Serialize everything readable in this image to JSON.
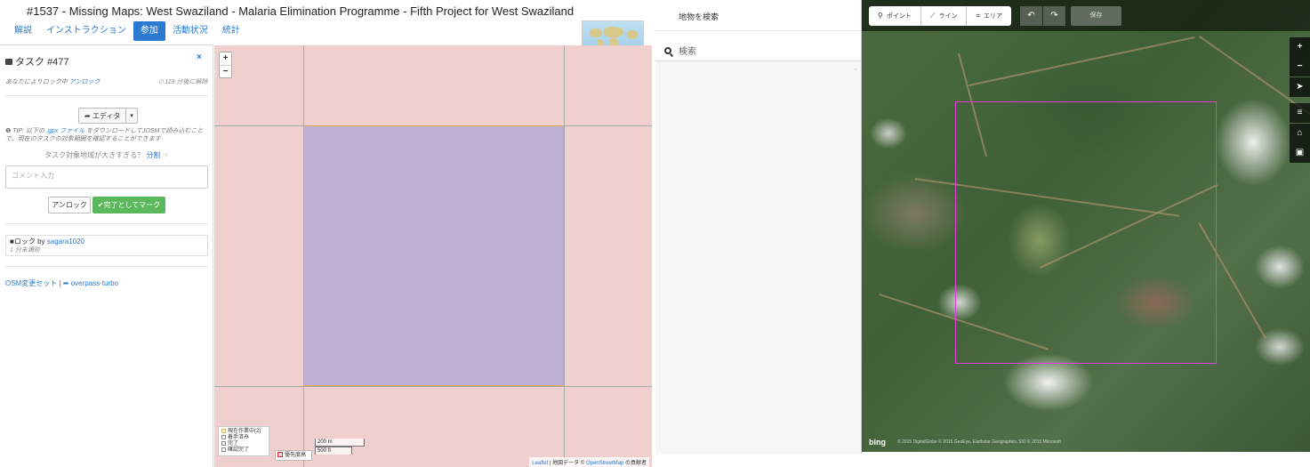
{
  "tm": {
    "title": "#1537 - Missing Maps: West Swaziland - Malaria Elimination Programme - Fifth Project for West Swaziland",
    "tabs": [
      "解説",
      "インストラクション",
      "参加",
      "活動状況",
      "統計"
    ],
    "active_tab": "参加",
    "task": {
      "title": "タスク #477",
      "close": "×",
      "locked_by_you": "あなたによりロック中",
      "unlock_link": "アンロック",
      "unlock_time": "119 分後に解除",
      "editor_label": "エディタ",
      "tip_prefix": "TIP: 以下の",
      "tip_link": ".gpx ファイル",
      "tip_suffix": "をダウンロードしてJOSMで読み込むことで、現在のタスクの対象範囲を確認することができます",
      "split_prompt": "タスク対象地域が大きすぎる？",
      "split_link": "分割",
      "comment_placeholder": "コメント入力",
      "unlock_button": "アンロック",
      "done_button": "完了としてマーク",
      "history_lock": "ロック by",
      "history_user": "sagara1020",
      "history_ago": "1 分未満前",
      "link_changesets": "OSM変更セット",
      "link_overpass": "overpass-turbo"
    },
    "map": {
      "zoom_in": "+",
      "zoom_out": "−",
      "legend": [
        "現在作業中(2)",
        "着手済み",
        "完了",
        "確認完了"
      ],
      "priority_label": "優先度高",
      "scale_m": "200 m",
      "scale_ft": "500 ft",
      "attrib_leaflet": "Leaflet",
      "attrib_mid": "| 地図データ ©",
      "attrib_osm": "OpenStreetMap",
      "attrib_end": "の貢献者"
    }
  },
  "id": {
    "sidebar_title": "地物を検索",
    "search_placeholder": "検索",
    "tools": {
      "point": "ポイント",
      "line": "ライン",
      "area": "エリア",
      "save": "保存"
    },
    "controls": [
      "+",
      "−",
      "➤",
      "≡",
      "⌂",
      "▣"
    ],
    "bing": "bing",
    "copyright": "© 2015 DigitalGlobe  © 2015 GeoEye, Earthstar Geographics SIO  © 2015 Microsoft"
  },
  "colors": {
    "tm_blue": "#2a7ad2",
    "done_green": "#5cb85c",
    "task_fill": "#bfb0d5",
    "grid_fill": "#efd0cf",
    "task_outline": "#e13de0"
  }
}
